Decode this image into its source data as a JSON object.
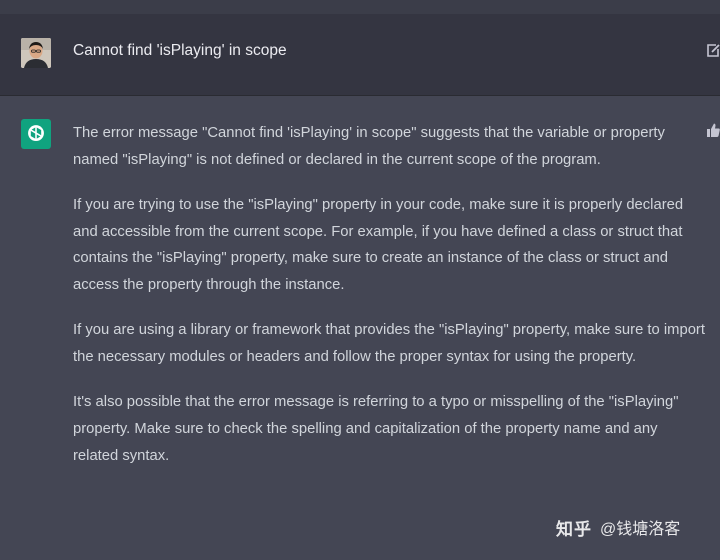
{
  "conversation": {
    "user_message": "Cannot find 'isPlaying' in scope",
    "assistant_paragraphs": [
      "The error message \"Cannot find 'isPlaying' in scope\" suggests that the variable or property named \"isPlaying\" is not defined or declared in the current scope of the program.",
      "If you are trying to use the \"isPlaying\" property in your code, make sure it is properly declared and accessible from the current scope. For example, if you have defined a class or struct that contains the \"isPlaying\" property, make sure to create an instance of the class or struct and access the property through the instance.",
      "If you are using a library or framework that provides the \"isPlaying\" property, make sure to import the necessary modules or headers and follow the proper syntax for using the property.",
      "It's also possible that the error message is referring to a typo or misspelling of the \"isPlaying\" property. Make sure to check the spelling and capitalization of the property name and any related syntax."
    ]
  },
  "watermark": {
    "brand": "知乎",
    "handle": "@钱塘洛客"
  },
  "icons": {
    "user_avatar": "user-avatar-photo",
    "assistant_avatar": "openai-logo-icon",
    "edit": "edit-icon",
    "feedback": "thumbs-up-icon"
  },
  "colors": {
    "user_row_bg": "#343541",
    "assistant_row_bg": "#444654",
    "logo_green": "#10a37f",
    "text": "#d1d5db"
  }
}
